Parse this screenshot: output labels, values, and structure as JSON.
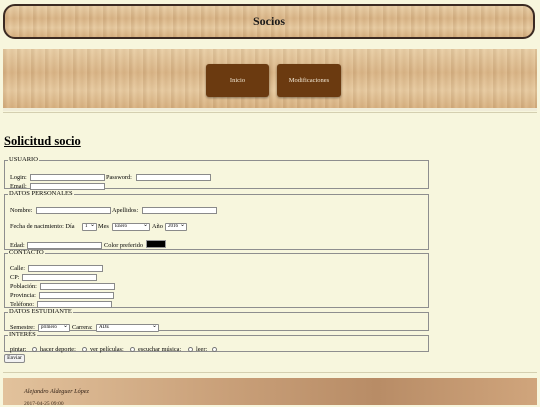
{
  "header": {
    "title": "Socios"
  },
  "nav": {
    "items": [
      {
        "label": "Inicio"
      },
      {
        "label": "Modificaciones"
      }
    ]
  },
  "form": {
    "title": "Solicitud socio",
    "usuario": {
      "legend": "USUARIO",
      "login_label": "Login:",
      "password_label": "Password:",
      "email_label": "Email:"
    },
    "personales": {
      "legend": "DATOS PERSONALES",
      "nombre_label": "Nombre:",
      "apellidos_label": "Apellidos:",
      "fecha_label": "Fecha de nacimiento: Día",
      "dia_value": "1",
      "mes_label": "Mes",
      "mes_value": "Enero",
      "anio_label": "Año",
      "anio_value": "2016",
      "edad_label": "Edad:",
      "color_label": "Color preferido",
      "color_value": "#000000"
    },
    "contacto": {
      "legend": "CONTACTO",
      "calle_label": "Calle:",
      "cp_label": "CP:",
      "poblacion_label": "Población:",
      "provincia_label": "Provincia:",
      "telefono_label": "Teléfono:"
    },
    "estudiante": {
      "legend": "DATOS ESTUDIANTE",
      "semestre_label": "Semestre:",
      "semestre_value": "primero",
      "carrera_label": "Carrera:",
      "carrera_value": "ADE"
    },
    "intereses": {
      "legend": "INTERÉS",
      "options": [
        {
          "label": "pintar:"
        },
        {
          "label": "hacer deporte:"
        },
        {
          "label": "ver películas:"
        },
        {
          "label": "escuchar música:"
        },
        {
          "label": "leer:"
        }
      ]
    },
    "submit_label": "Enviar"
  },
  "footer": {
    "author": "Alejandro Aldeguer López",
    "date": "2017-04-25 09:00"
  }
}
